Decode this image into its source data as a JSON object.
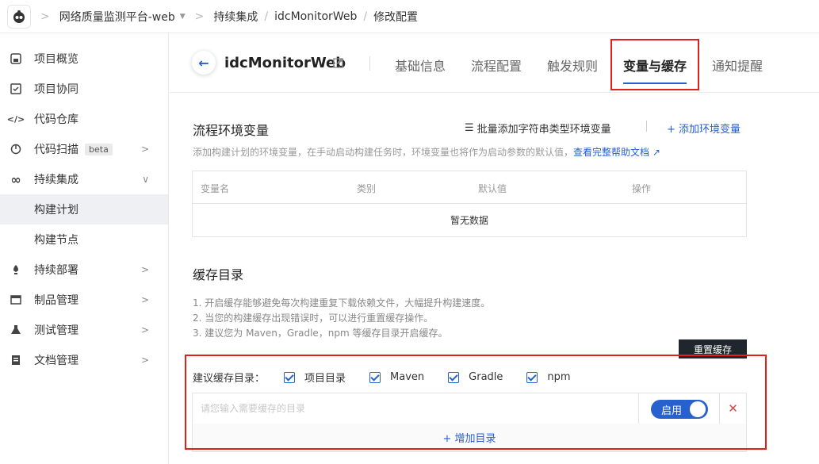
{
  "breadcrumb": {
    "project": "网络质量监测平台-web",
    "section": "持续集成",
    "repo": "idcMonitorWeb",
    "page": "修改配置"
  },
  "sidebar": {
    "items": [
      {
        "label": "项目概览",
        "icon": "home-icon"
      },
      {
        "label": "项目协同",
        "icon": "check-square-icon"
      },
      {
        "label": "代码仓库",
        "icon": "code-icon"
      },
      {
        "label": "代码扫描",
        "badge": "beta",
        "icon": "scan-icon"
      },
      {
        "label": "持续集成",
        "icon": "infinity-icon"
      },
      {
        "label": "构建计划"
      },
      {
        "label": "构建节点"
      },
      {
        "label": "持续部署",
        "icon": "rocket-icon"
      },
      {
        "label": "制品管理",
        "icon": "package-icon"
      },
      {
        "label": "测试管理",
        "icon": "flask-icon"
      },
      {
        "label": "文档管理",
        "icon": "doc-icon"
      }
    ]
  },
  "header": {
    "title": "idcMonitorWeb",
    "tabs": [
      "基础信息",
      "流程配置",
      "触发规则",
      "变量与缓存",
      "通知提醒"
    ],
    "active_tab": "变量与缓存"
  },
  "env": {
    "title": "流程环境变量",
    "batch_add": "批量添加字符串类型环境变量",
    "add": "+ 添加环境变量",
    "help": "添加构建计划的环境变量，在手动启动构建任务时，环境变量也将作为启动参数的默认值，",
    "help_link": "查看完整帮助文档",
    "columns": [
      "变量名",
      "类别",
      "默认值",
      "操作"
    ],
    "empty": "暂无数据"
  },
  "cache": {
    "title": "缓存目录",
    "tips": [
      "1. 开启缓存能够避免每次构建重复下载依赖文件，大幅提升构建速度。",
      "2. 当您的构建缓存出现错误时，可以进行重置缓存操作。",
      "3. 建议您为 Maven，Gradle，npm 等缓存目录开启缓存。"
    ],
    "reset": "重置缓存",
    "suggest_label": "建议缓存目录：",
    "options": [
      "项目目录",
      "Maven",
      "Gradle",
      "npm"
    ],
    "input_placeholder": "请您输入需要缓存的目录",
    "toggle_label": "启用",
    "add_dir": "+ 增加目录"
  },
  "colors": {
    "accent": "#2761ce",
    "highlight": "#e0201a"
  }
}
